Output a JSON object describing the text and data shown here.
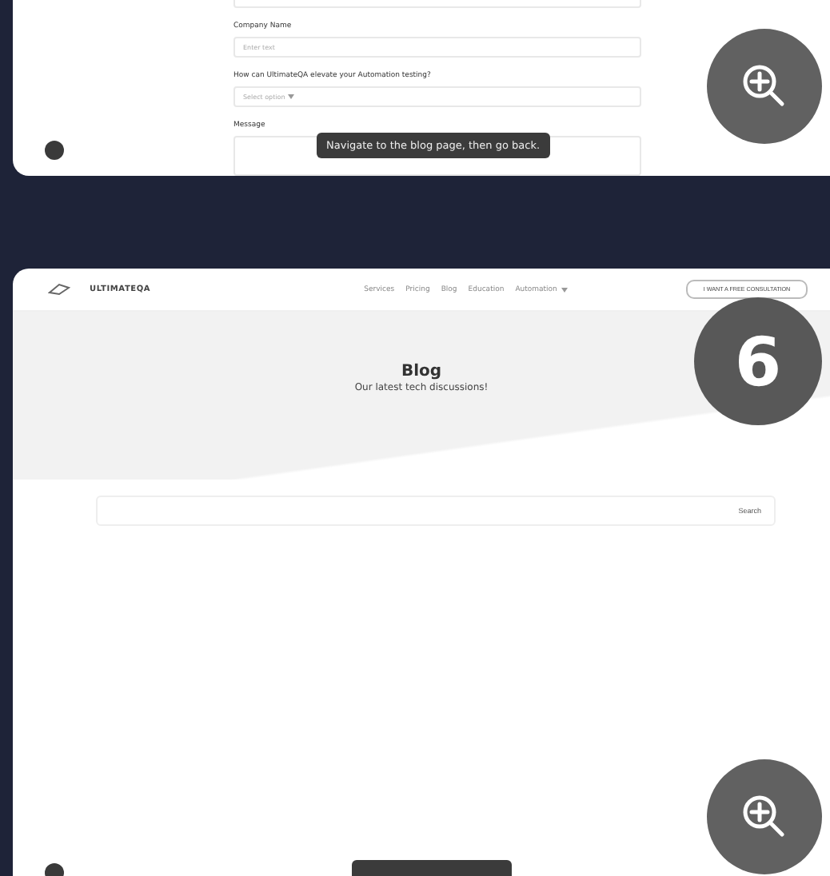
{
  "top_panel": {
    "fields": [
      {
        "kind": "input"
      },
      {
        "kind": "input",
        "label": "Company Name",
        "placeholder": "Enter text"
      },
      {
        "kind": "select",
        "label": "How can UltimateQA elevate your Automation testing?",
        "placeholder": "Select option"
      },
      {
        "kind": "textarea",
        "label": "Message"
      }
    ],
    "tooltip": "Navigate to the blog page, then go back."
  },
  "bottom_panel": {
    "logo": "ULTIMATEQA",
    "nav": [
      {
        "label": "Services",
        "dropdown": false
      },
      {
        "label": "Pricing",
        "dropdown": false
      },
      {
        "label": "Blog",
        "dropdown": false
      },
      {
        "label": "Education",
        "dropdown": false
      },
      {
        "label": "Automation",
        "dropdown": true
      }
    ],
    "cta": "I WANT A FREE CONSULTATION",
    "step": "6",
    "title": "Blog",
    "subtitle": "Our latest tech discussions!",
    "search": {
      "button": "Search"
    }
  }
}
